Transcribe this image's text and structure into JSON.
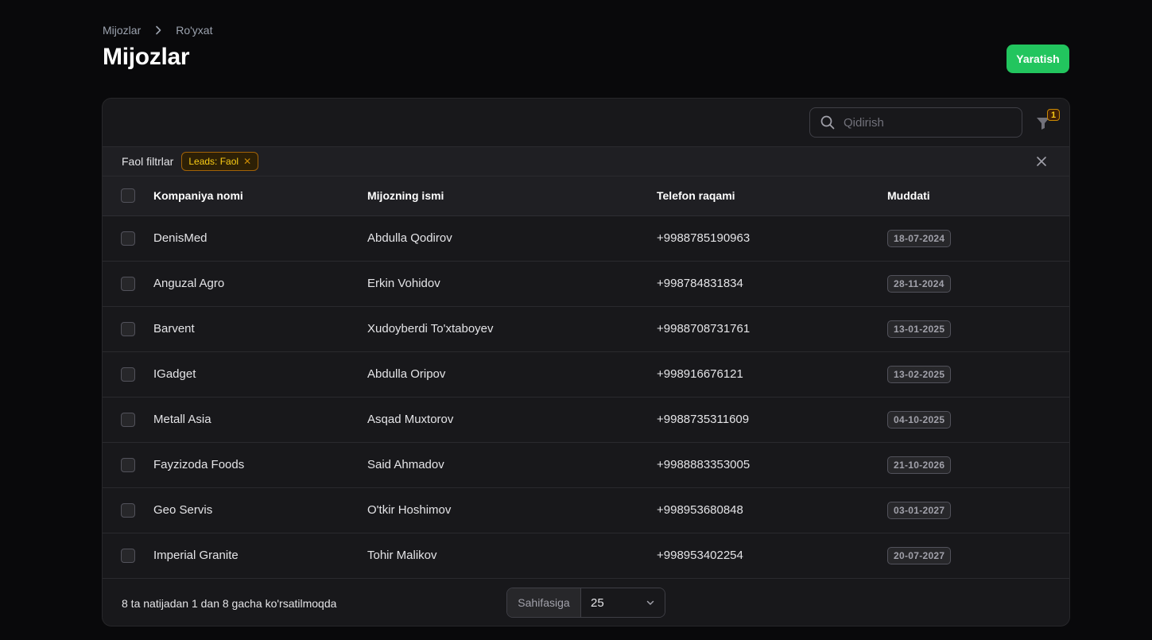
{
  "breadcrumb": {
    "items": [
      "Mijozlar",
      "Ro'yxat"
    ]
  },
  "page": {
    "title": "Mijozlar",
    "create_label": "Yaratish"
  },
  "colors": {
    "accent": "#22c55e",
    "filter_badge": "#facc15",
    "background": "#09090b",
    "card": "#18181b"
  },
  "toolbar": {
    "search_placeholder": "Qidirish",
    "filter_count": "1",
    "filter_icon": "funnel-icon",
    "search_icon": "search-icon"
  },
  "active_filters": {
    "label": "Faol filtrlar",
    "chips": [
      {
        "label": "Leads: Faol"
      }
    ]
  },
  "table": {
    "columns": [
      "Kompaniya nomi",
      "Mijozning ismi",
      "Telefon raqami",
      "Muddati"
    ],
    "rows": [
      {
        "company": "DenisMed",
        "client": "Abdulla Qodirov",
        "phone": "+9988785190963",
        "due": "18-07-2024"
      },
      {
        "company": "Anguzal Agro",
        "client": "Erkin Vohidov",
        "phone": "+998784831834",
        "due": "28-11-2024"
      },
      {
        "company": "Barvent",
        "client": "Xudoyberdi To'xtaboyev",
        "phone": "+9988708731761",
        "due": "13-01-2025"
      },
      {
        "company": "IGadget",
        "client": "Abdulla Oripov",
        "phone": "+998916676121",
        "due": "13-02-2025"
      },
      {
        "company": "Metall Asia",
        "client": "Asqad Muxtorov",
        "phone": "+9988735311609",
        "due": "04-10-2025"
      },
      {
        "company": "Fayzizoda Foods",
        "client": "Said Ahmadov",
        "phone": "+9988883353005",
        "due": "21-10-2026"
      },
      {
        "company": "Geo Servis",
        "client": "O'tkir Hoshimov",
        "phone": "+998953680848",
        "due": "03-01-2027"
      },
      {
        "company": "Imperial Granite",
        "client": "Tohir Malikov",
        "phone": "+998953402254",
        "due": "20-07-2027"
      }
    ]
  },
  "footer": {
    "results_text": "8 ta natijadan 1 dan 8 gacha ko'rsatilmoqda",
    "per_page_label": "Sahifasiga",
    "per_page_value": "25"
  }
}
